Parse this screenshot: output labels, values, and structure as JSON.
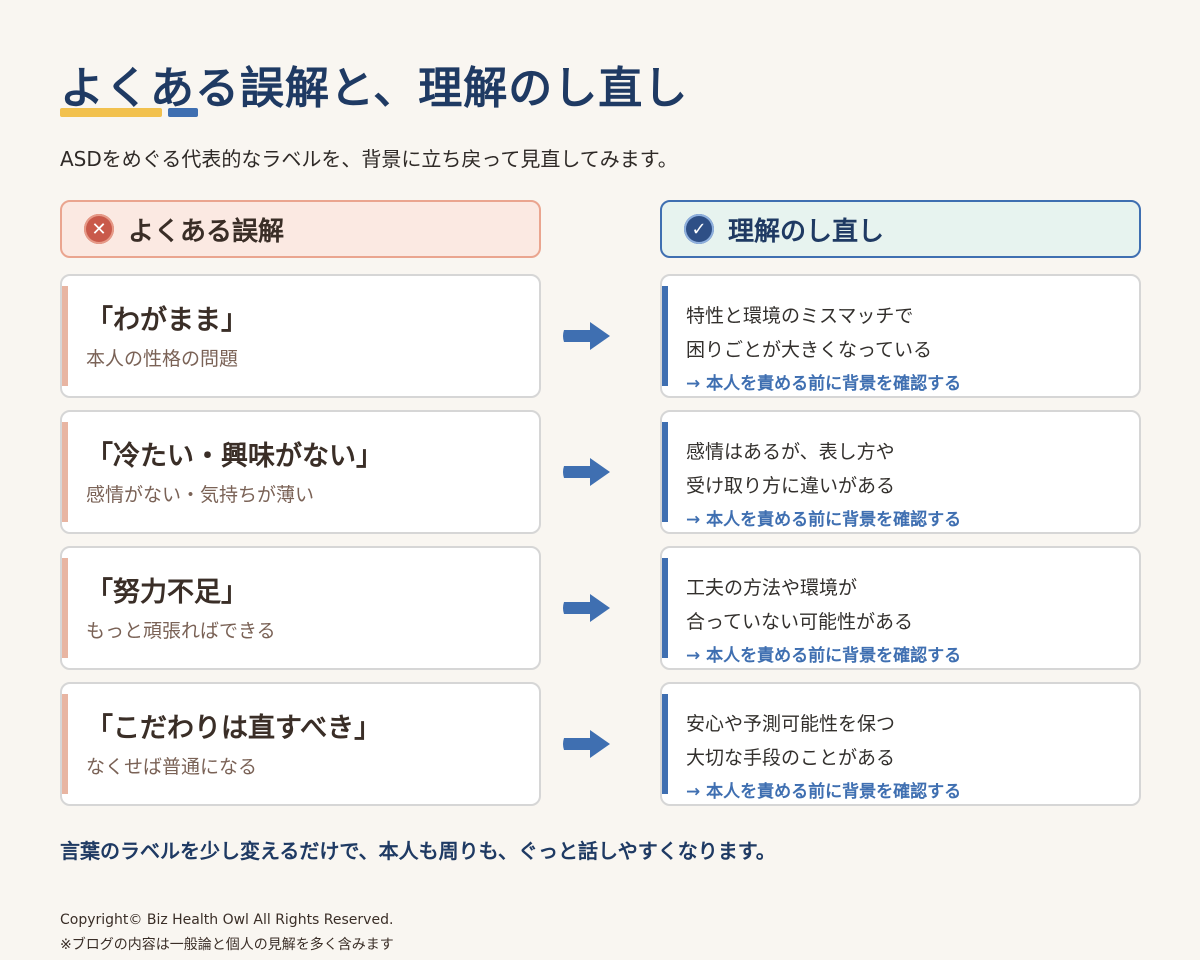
{
  "title": "よくある誤解と、理解のし直し",
  "subtitle": "ASDをめぐる代表的なラベルを、背景に立ち戻って見直してみます。",
  "headers": {
    "left": {
      "icon": "x-circle-icon",
      "label": "よくある誤解"
    },
    "right": {
      "icon": "check-circle-icon",
      "label": "理解のし直し"
    }
  },
  "rows": [
    {
      "myth": "「わがまま」",
      "myth_sub": "本人の性格の問題",
      "reframe_line1": "特性と環境のミスマッチで",
      "reframe_line2": "困りごとが大きくなっている",
      "note": "→ 本人を責める前に背景を確認する"
    },
    {
      "myth": "「冷たい・興味がない」",
      "myth_sub": "感情がない・気持ちが薄い",
      "reframe_line1": "感情はあるが、表し方や",
      "reframe_line2": "受け取り方に違いがある",
      "note": "→ 本人を責める前に背景を確認する"
    },
    {
      "myth": "「努力不足」",
      "myth_sub": "もっと頑張ればできる",
      "reframe_line1": "工夫の方法や環境が",
      "reframe_line2": "合っていない可能性がある",
      "note": "→ 本人を責める前に背景を確認する"
    },
    {
      "myth": "「こだわりは直すべき」",
      "myth_sub": "なくせば普通になる",
      "reframe_line1": "安心や予測可能性を保つ",
      "reframe_line2": "大切な手段のことがある",
      "note": "→ 本人を責める前に背景を確認する"
    }
  ],
  "footer_message": "言葉のラベルを少し変えるだけで、本人も周りも、ぐっと話しやすくなります。",
  "copyright": "Copyright© Biz Health Owl All Rights Reserved.",
  "disclaimer": "※ブログの内容は一般論と個人の見解を多く含みます",
  "colors": {
    "navy": "#1f3a63",
    "blue": "#3f6fb1",
    "yellow": "#f2c14e",
    "coral": "#c9594a",
    "myth_accent": "#e8b5a2",
    "background": "#f9f6f1"
  }
}
